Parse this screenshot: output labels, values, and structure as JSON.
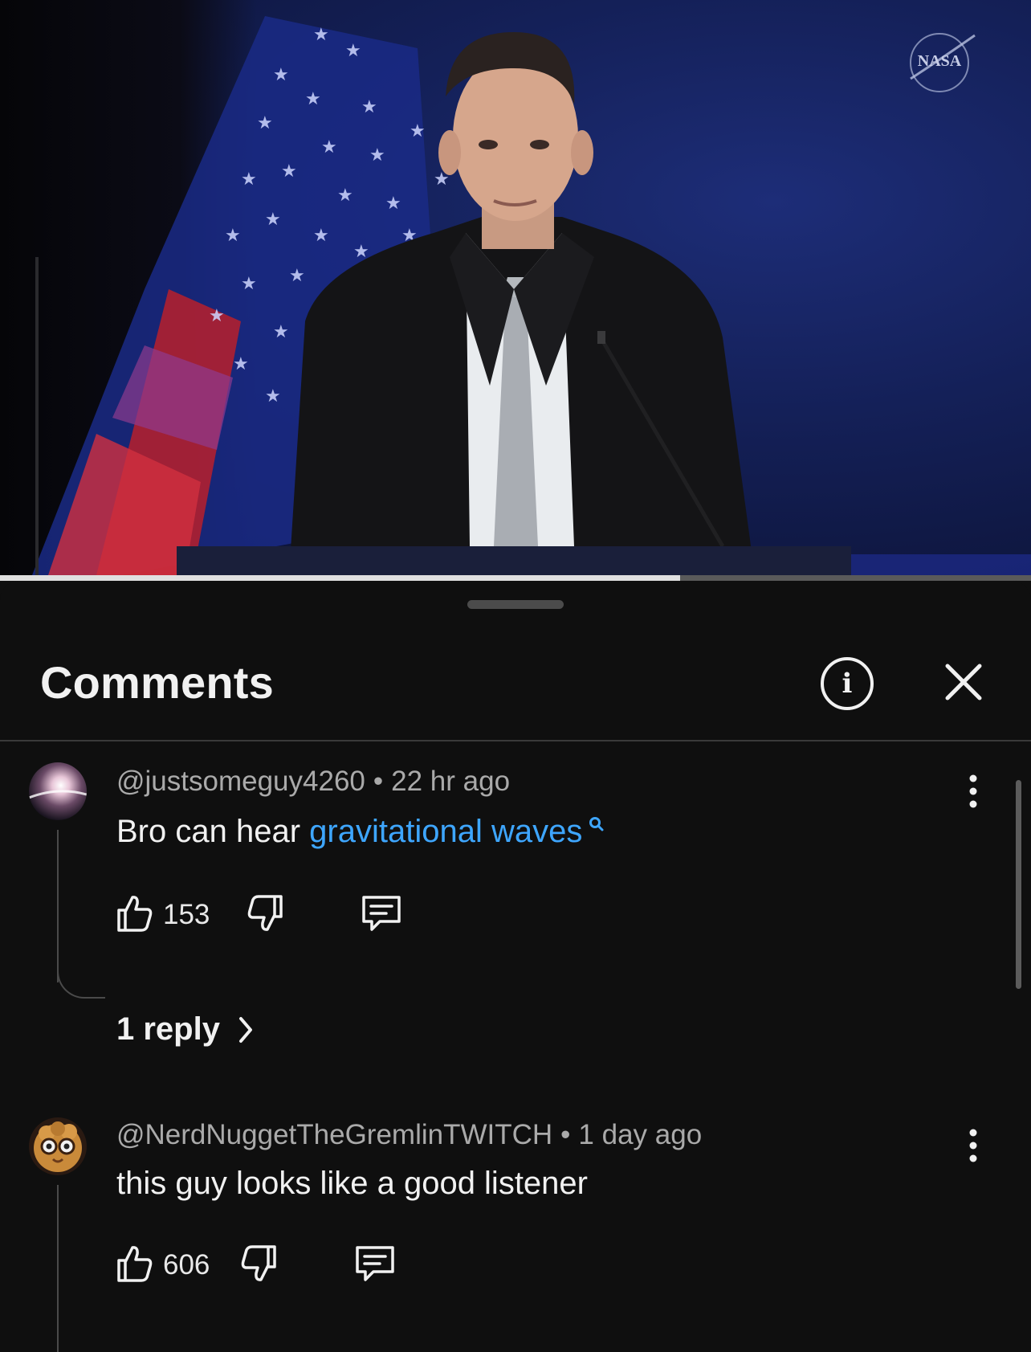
{
  "video": {
    "logo_text": "NASA",
    "progress_fraction": 0.66
  },
  "sheet": {
    "title": "Comments"
  },
  "comments": [
    {
      "author": "@justsomeguy4260",
      "time": "22 hr ago",
      "text_plain": "Bro can hear ",
      "text_link": "gravitational waves",
      "likes": "153",
      "replies_label": "1 reply"
    },
    {
      "author": "@NerdNuggetTheGremlinTWITCH",
      "time": "1 day ago",
      "text_plain": "this guy looks like a good listener",
      "likes": "606"
    }
  ],
  "colors": {
    "background": "#0f0f0f",
    "link": "#3ea6ff",
    "secondary_text": "#aaaaaa"
  },
  "icons": [
    "info-icon",
    "close-icon",
    "more-vert-icon",
    "thumb-up-icon",
    "thumb-down-icon",
    "reply-icon",
    "chevron-right-icon",
    "search-icon"
  ]
}
